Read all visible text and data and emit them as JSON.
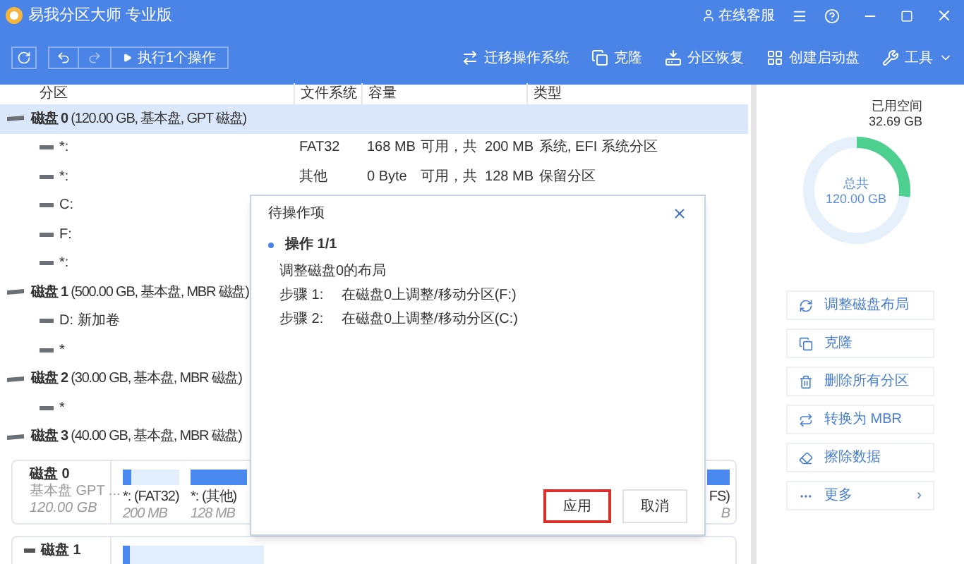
{
  "window": {
    "title": "易我分区大师 专业版",
    "support": "在线客服"
  },
  "toolbar": {
    "execute": "执行1个操作",
    "actions": [
      {
        "kind": "migrate",
        "label": "迁移操作系统"
      },
      {
        "kind": "clone",
        "label": "克隆"
      },
      {
        "kind": "recover",
        "label": "分区恢复"
      },
      {
        "kind": "boot",
        "label": "创建启动盘"
      },
      {
        "kind": "tools",
        "label": "工具"
      }
    ]
  },
  "table": {
    "columns": [
      "分区",
      "文件系统",
      "容量",
      "类型"
    ],
    "rows": [
      {
        "kind": "disk",
        "disk": "磁盘 0",
        "info": "(120.00 GB, 基本盘, GPT 磁盘)",
        "selected": true
      },
      {
        "kind": "partition",
        "name": "*:",
        "fs": "FAT32",
        "free": "168 MB",
        "capacity": "可用，共  200 MB",
        "type": "系统, EFI 系统分区",
        "selected": false
      },
      {
        "kind": "partition",
        "name": "*:",
        "fs": "其他",
        "free": "0 Byte",
        "capacity": "可用，共  128 MB",
        "type": "保留分区",
        "selected": false
      },
      {
        "kind": "partition",
        "name": "C:",
        "selected": false
      },
      {
        "kind": "partition",
        "name": "F:",
        "selected": false
      },
      {
        "kind": "partition",
        "name": "*:",
        "selected": false
      },
      {
        "kind": "disk",
        "disk": "磁盘 1",
        "info": "(500.00 GB, 基本盘, MBR 磁盘)",
        "selected": false
      },
      {
        "kind": "partition",
        "name": "D: 新加卷",
        "selected": false
      },
      {
        "kind": "partition",
        "name": "*",
        "selected": false
      },
      {
        "kind": "disk",
        "disk": "磁盘 2",
        "info": "(30.00 GB, 基本盘, MBR 磁盘)",
        "selected": false
      },
      {
        "kind": "partition",
        "name": "*",
        "selected": false
      },
      {
        "kind": "disk",
        "disk": "磁盘 3",
        "info": "(40.00 GB, 基本盘, MBR 磁盘)",
        "selected": false
      }
    ]
  },
  "disk_map": [
    {
      "name": "磁盘 0",
      "type": "基本盘 GPT ...",
      "size": "120.00 GB",
      "partitions": [
        {
          "label": "*: (FAT32)",
          "size": "200 MB",
          "level": 0.15
        },
        {
          "label": "*: (其他)",
          "size": "128 MB",
          "level": 1
        },
        {
          "label": "FS)",
          "size": "B",
          "level": 1
        }
      ]
    },
    {
      "name": "磁盘 1",
      "partitions": [
        {
          "level": 0.05
        }
      ]
    }
  ],
  "dialog": {
    "title": "待操作项",
    "operation": "操作 1/1",
    "description": "调整磁盘0的布局",
    "steps": [
      {
        "label": "步骤 1:",
        "text": "在磁盘0上调整/移动分区(F:)"
      },
      {
        "label": "步骤 2:",
        "text": "在磁盘0上调整/移动分区(C:)"
      }
    ],
    "apply": "应用",
    "cancel": "取消"
  },
  "usage": {
    "used_label": "已用空间",
    "used": "32.69 GB",
    "total_label": "总共",
    "total": "120.00 GB",
    "level": 0.27
  },
  "actions": [
    {
      "kind": "layout",
      "label": "调整磁盘布局"
    },
    {
      "kind": "clone",
      "label": "克隆"
    },
    {
      "kind": "delete",
      "label": "删除所有分区"
    },
    {
      "kind": "convert",
      "label": "转换为 MBR"
    },
    {
      "kind": "wipe",
      "label": "擦除数据"
    },
    {
      "kind": "more",
      "label": "更多",
      "chevron": "›"
    }
  ]
}
